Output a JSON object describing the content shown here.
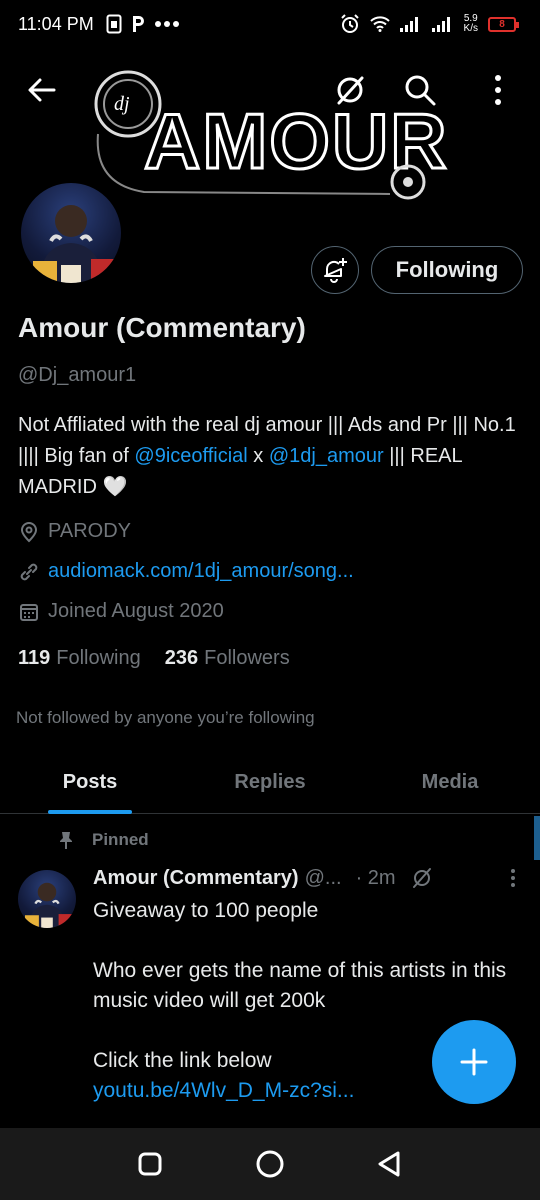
{
  "status_bar": {
    "time": "11:04 PM",
    "net_speed_value": "5.9",
    "net_speed_unit": "K/s",
    "battery_level": "8",
    "icons": [
      "sim-icon",
      "p-icon",
      "more-dots-icon",
      "alarm-icon",
      "wifi-icon",
      "signal-icon",
      "signal-icon",
      "battery-icon"
    ]
  },
  "header": {
    "banner_text": "AMOUR",
    "banner_prefix": "dj"
  },
  "profile": {
    "name": "Amour (Commentary)",
    "handle": "@Dj_amour1",
    "following_button": "Following",
    "bio": {
      "part1": "Not Affliated with the real dj amour ||| Ads and Pr ||| No.1 |||| Big fan of ",
      "mention1": "@9iceofficial",
      "part2": " x ",
      "mention2": "@1dj_amour",
      "part3": " ||| REAL MADRID 🤍"
    },
    "location": "PARODY",
    "website": "audiomack.com/1dj_amour/song...",
    "joined": "Joined August 2020",
    "following_count": "119",
    "following_label": "Following",
    "followers_count": "236",
    "followers_label": "Followers",
    "not_followed_text": "Not followed by anyone you’re following"
  },
  "tabs": [
    {
      "label": "Posts",
      "active": true
    },
    {
      "label": "Replies",
      "active": false
    },
    {
      "label": "Media",
      "active": false
    }
  ],
  "pinned_post": {
    "pinned_label": "Pinned",
    "author": "Amour (Commentary)",
    "handle": "@...",
    "time": "· 2m",
    "lines": [
      "Giveaway to 100 people",
      "",
      "Who ever gets the name of this artists in this music video will get 200k",
      "",
      "Click the link below"
    ],
    "link": "youtu.be/4Wlv_D_M-zc?si..."
  },
  "colors": {
    "accent": "#1d9bf0",
    "background": "#000000",
    "secondary_text": "#71767b",
    "primary_text": "#e7e9ea",
    "battery_low": "#e0312c"
  }
}
